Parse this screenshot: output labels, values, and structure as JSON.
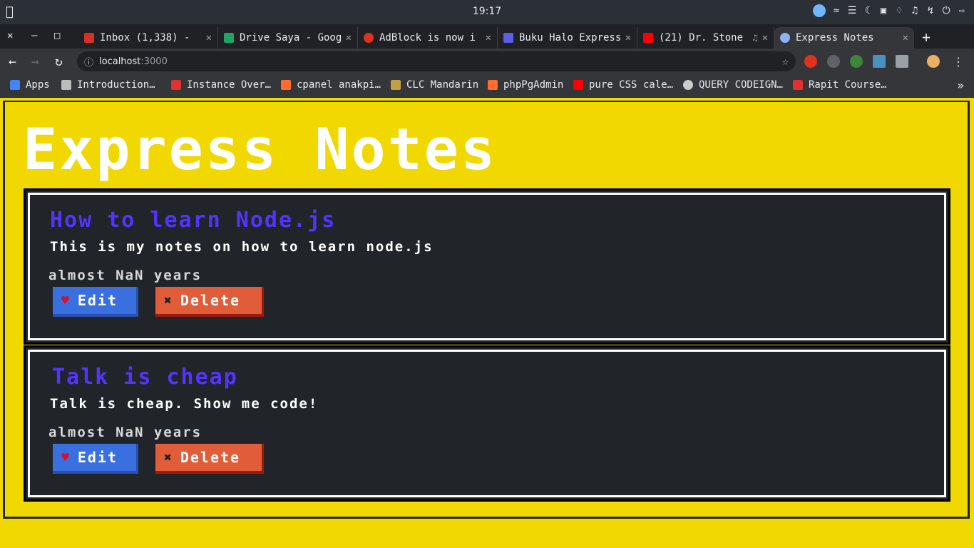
{
  "os": {
    "clock": "19:17"
  },
  "tabs": [
    {
      "title": "Inbox (1,338) -",
      "color": "#d93025",
      "active": false
    },
    {
      "title": "Drive Saya - Goog",
      "color": "#1fa463",
      "active": false
    },
    {
      "title": "AdBlock is now i",
      "color": "#e0301e",
      "active": false
    },
    {
      "title": "Buku Halo Express",
      "color": "#5b5fe0",
      "active": false
    },
    {
      "title": "(21) Dr. Stone",
      "color": "#ff0000",
      "active": false
    },
    {
      "title": "Express Notes",
      "color": "#8ab4f8",
      "active": true
    }
  ],
  "address": {
    "host": "localhost",
    "port": ":3000"
  },
  "bookmarks": [
    {
      "label": "Apps",
      "color": "#4285f4"
    },
    {
      "label": "Introduction…",
      "color": "#bbbbbb"
    },
    {
      "label": "Instance Over…",
      "color": "#e03030"
    },
    {
      "label": "cpanel anakpi…",
      "color": "#ff6c2c"
    },
    {
      "label": "CLC Mandarin",
      "color": "#c0a040"
    },
    {
      "label": "phpPgAdmin",
      "color": "#ff6c2c"
    },
    {
      "label": "pure CSS cale…",
      "color": "#ff0000"
    },
    {
      "label": "QUERY CODEIGN…",
      "color": "#cccccc"
    },
    {
      "label": "Rapit Course…",
      "color": "#e03030"
    }
  ],
  "page": {
    "heading": "Express Notes",
    "notes": [
      {
        "title": "How to learn Node.js",
        "body": "This is my notes on how to learn node.js",
        "time": "almost NaN years",
        "edit_label": "Edit",
        "delete_label": "Delete"
      },
      {
        "title": "Talk is cheap",
        "body": "Talk is cheap. Show me code!",
        "time": "almost NaN years",
        "edit_label": "Edit",
        "delete_label": "Delete"
      }
    ]
  },
  "colors": {
    "page_bg": "#f0d800",
    "note_bg": "#212529",
    "title": "#5533ff",
    "edit": "#3a6fe0",
    "delete": "#e15d3a"
  }
}
